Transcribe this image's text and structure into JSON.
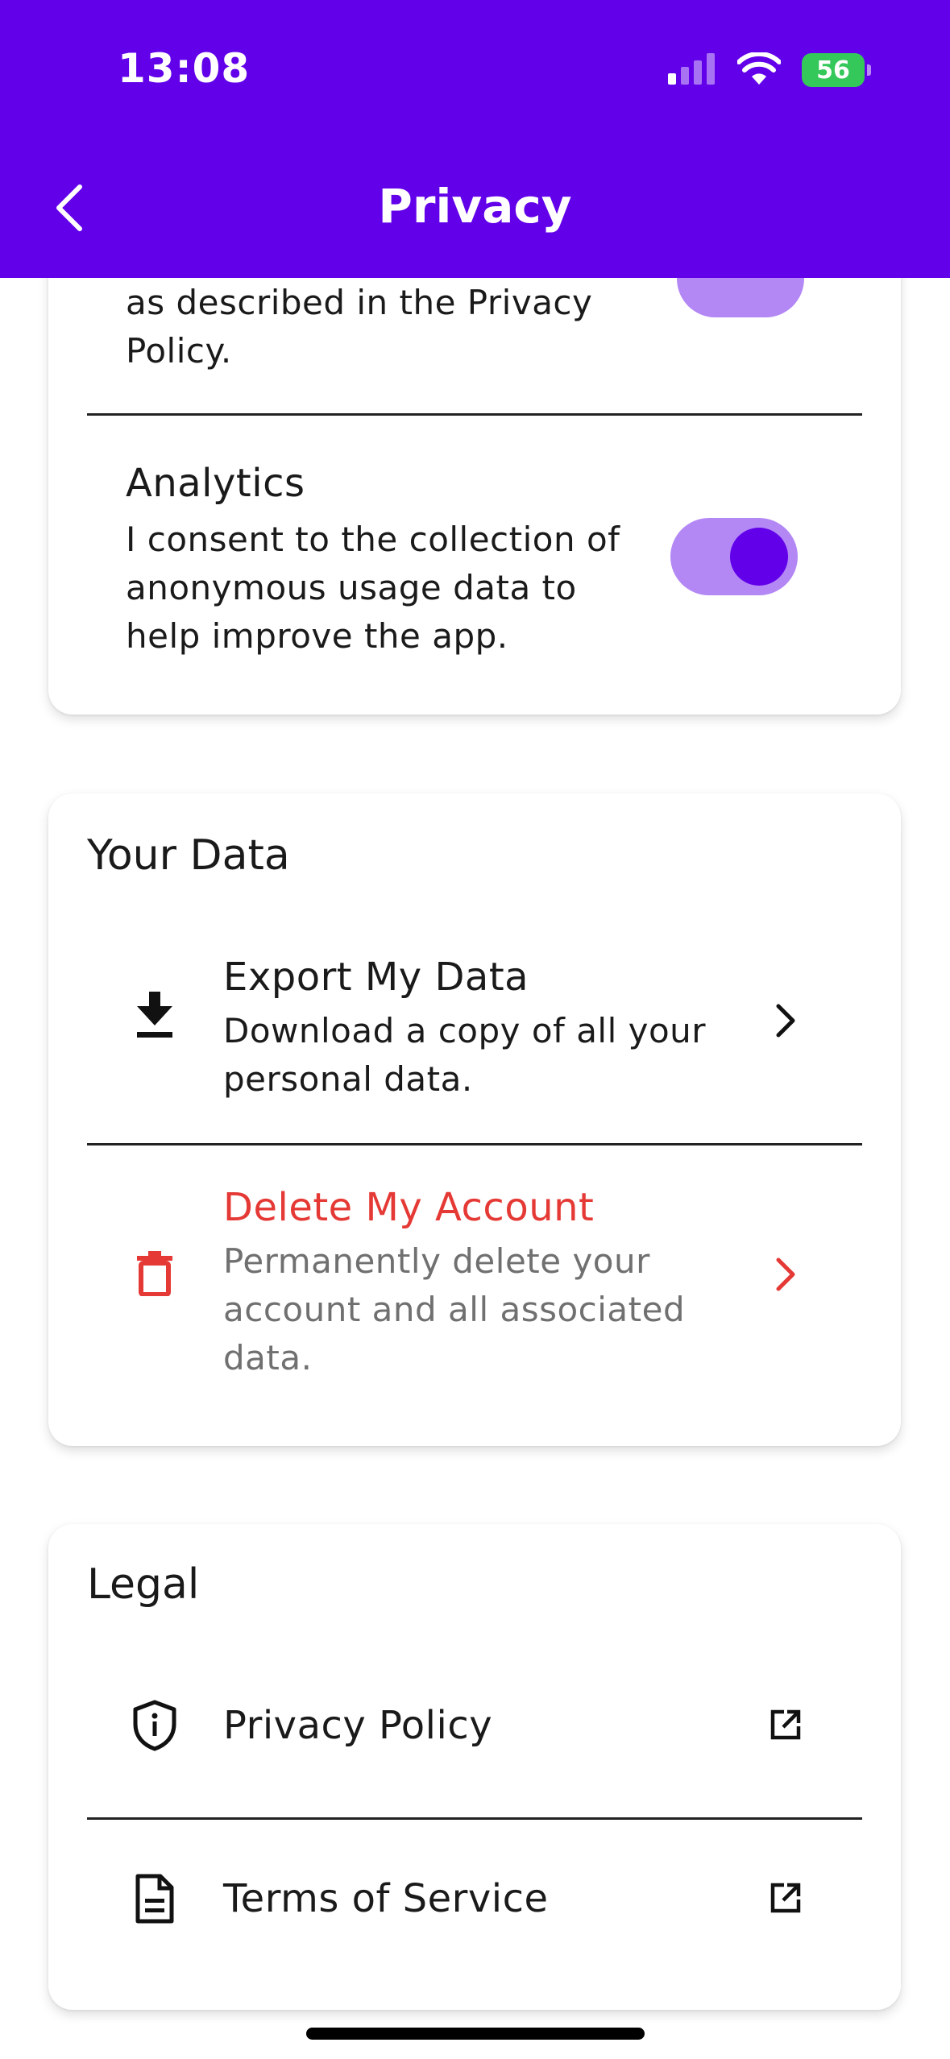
{
  "status_bar": {
    "time": "13:08",
    "battery": "56"
  },
  "header": {
    "title": "Privacy"
  },
  "consent": {
    "partial_description": "as described in the Privacy Policy.",
    "analytics": {
      "title": "Analytics",
      "description": "I consent to the collection of anonymous usage data to help improve the app.",
      "enabled": true
    }
  },
  "your_data": {
    "title": "Your Data",
    "export": {
      "title": "Export My Data",
      "description": "Download a copy of all your personal data."
    },
    "delete": {
      "title": "Delete My Account",
      "description": "Permanently delete your account and all associated data."
    }
  },
  "legal": {
    "title": "Legal",
    "privacy_policy": "Privacy Policy",
    "terms_of_service": "Terms of Service"
  },
  "colors": {
    "primary": "#6200EA",
    "toggle_track": "#b388f5",
    "danger": "#E53935",
    "battery": "#34C759"
  }
}
